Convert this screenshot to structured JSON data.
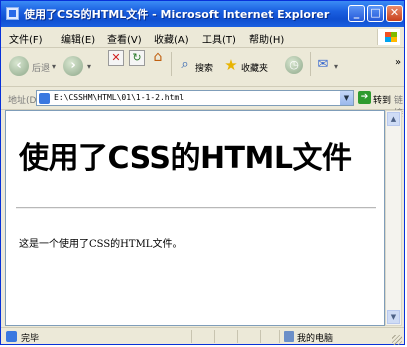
{
  "window": {
    "title": "使用了CSS的HTML文件 - Microsoft Internet Explorer",
    "minimize_symbol": "_",
    "maximize_symbol": "□",
    "close_symbol": "✕"
  },
  "menu": {
    "items": [
      "文件(F)",
      "编辑(E)",
      "查看(V)",
      "收藏(A)",
      "工具(T)",
      "帮助(H)"
    ]
  },
  "toolbar": {
    "back_label": "后退",
    "search_label": "搜索",
    "favorites_label": "收藏夹",
    "more_symbol": "»"
  },
  "address": {
    "label": "地址(D)",
    "url": "E:\\CSSHM\\HTML\\01\\1-1-2.html",
    "go_label": "转到",
    "links_label": "链接"
  },
  "page": {
    "heading": "使用了CSS的HTML文件",
    "paragraph": "这是一个使用了CSS的HTML文件。"
  },
  "status": {
    "text": "完毕",
    "zone": "我的电脑"
  },
  "colors": {
    "titlebar": "#1a5fe0",
    "chrome": "#ece9d8",
    "content_bg": "#ffffff"
  }
}
